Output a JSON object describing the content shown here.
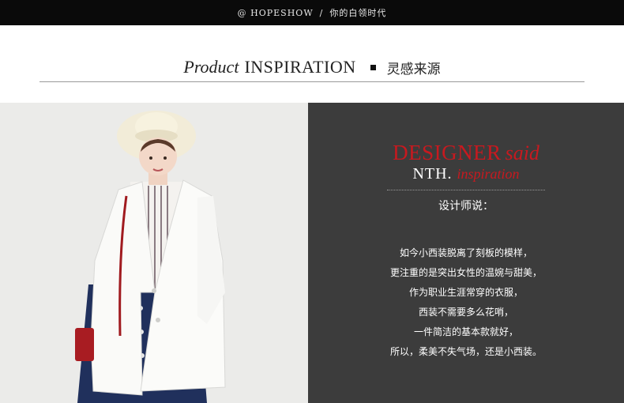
{
  "topbar": {
    "at": "@",
    "brand": "HOPESHOW",
    "slash": "/",
    "tagline": "你的白领时代"
  },
  "heading": {
    "product": "Product",
    "inspiration": "INSPIRATION",
    "cn": "灵感来源"
  },
  "panel": {
    "designer": "DESIGNER",
    "said": "said",
    "nth": "NTH.",
    "inspiration": "inspiration",
    "subtitle": "设计师说：",
    "lines": [
      "如今小西装脱离了刻板的模样，",
      "更注重的是突出女性的温婉与甜美，",
      "作为职业生涯常穿的衣服，",
      "西装不需要多么花哨，",
      "一件简洁的基本款就好，",
      "所以，柔美不失气场，还是小西装。"
    ]
  },
  "colors": {
    "accent": "#c8191f",
    "panel": "#3c3c3c",
    "topbar": "#0a0a0a"
  }
}
